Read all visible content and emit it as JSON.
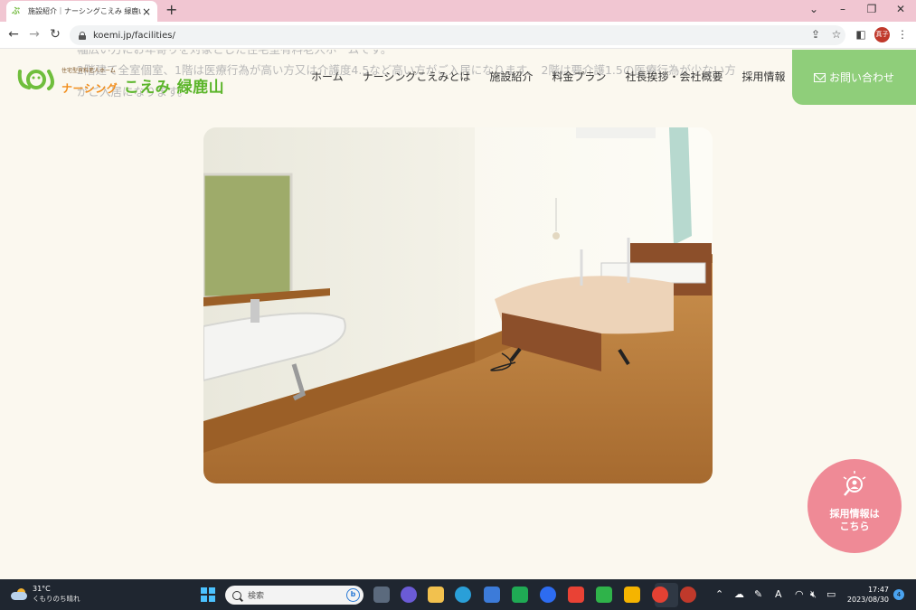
{
  "browser": {
    "tab_title": "施設紹介｜ナーシングこえみ 緑鹿山｜名古",
    "url": "koemi.jp/facilities/",
    "profile_label": "真子"
  },
  "page": {
    "bg_text_1": "幅広い方にお年寄りを対象とした住宅型有料老人ホームです。",
    "bg_text_2": "2階建て全室個室、1階は医療行為が高い方又は介護度4.5など高い方がご入居になります。 2階は要介護1.5の医療行為が少ない方",
    "bg_text_3": "がご入居になります。",
    "logo": {
      "sub": "住宅型有料老人ホーム",
      "main_prefix": "ナーシング",
      "main_name": "こえみ 緑鹿山"
    },
    "nav": [
      "ホーム",
      "ナーシングこえみとは",
      "施設紹介",
      "料金プラン",
      "社長挨拶・会社概要",
      "採用情報"
    ],
    "contact_label": "お問い合わせ",
    "recruit_badge": {
      "line1": "採用情報は",
      "line2": "こちら"
    },
    "photo_description": "Private room with sink, mirror and care bed"
  },
  "taskbar": {
    "weather_temp": "31°C",
    "weather_desc": "くもりのち晴れ",
    "search_placeholder": "検索",
    "clock_time": "17:47",
    "clock_date": "2023/08/30",
    "notification_count": "4"
  }
}
